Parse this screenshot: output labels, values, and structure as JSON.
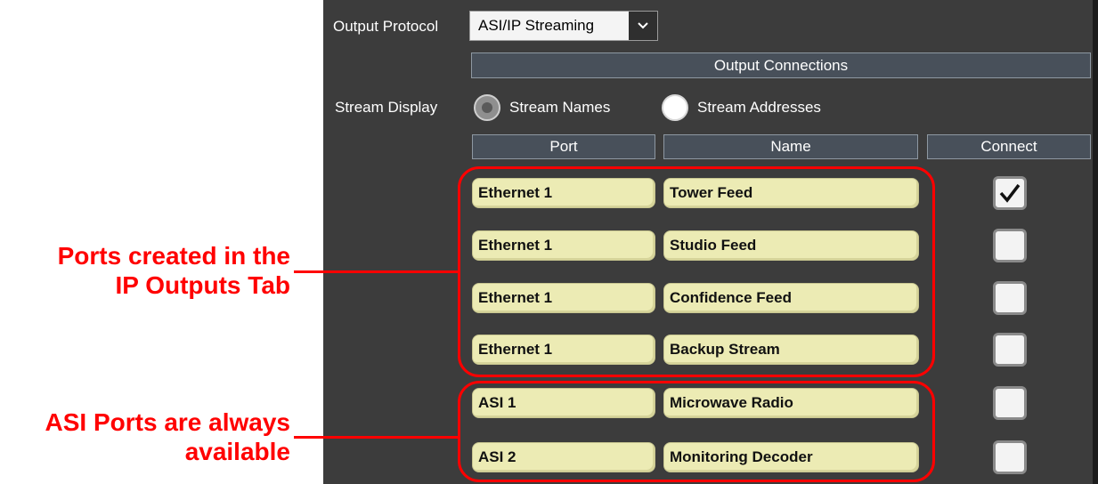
{
  "output_protocol": {
    "label": "Output Protocol",
    "value": "ASI/IP Streaming"
  },
  "output_connections_header": "Output Connections",
  "stream_display": {
    "label": "Stream Display",
    "options": [
      {
        "label": "Stream Names",
        "selected": true
      },
      {
        "label": "Stream Addresses",
        "selected": false
      }
    ]
  },
  "columns": {
    "port": "Port",
    "name": "Name",
    "connect": "Connect"
  },
  "rows": [
    {
      "port": "Ethernet 1",
      "name": "Tower Feed",
      "connected": true
    },
    {
      "port": "Ethernet 1",
      "name": "Studio Feed",
      "connected": false
    },
    {
      "port": "Ethernet 1",
      "name": "Confidence Feed",
      "connected": false
    },
    {
      "port": "Ethernet 1",
      "name": "Backup Stream",
      "connected": false
    },
    {
      "port": "ASI 1",
      "name": "Microwave Radio",
      "connected": false
    },
    {
      "port": "ASI 2",
      "name": "Monitoring Decoder",
      "connected": false
    }
  ],
  "annotations": {
    "ip_outputs_line1": "Ports created in the",
    "ip_outputs_line2": "IP Outputs Tab",
    "asi_line1": "ASI Ports are always",
    "asi_line2": "available"
  },
  "colors": {
    "annotation": "#ff0000",
    "field": "#ecebb4",
    "panel": "#3c3c3c"
  },
  "icons": {
    "dropdown": "chevron-down-icon",
    "checked": "checkmark-icon"
  }
}
